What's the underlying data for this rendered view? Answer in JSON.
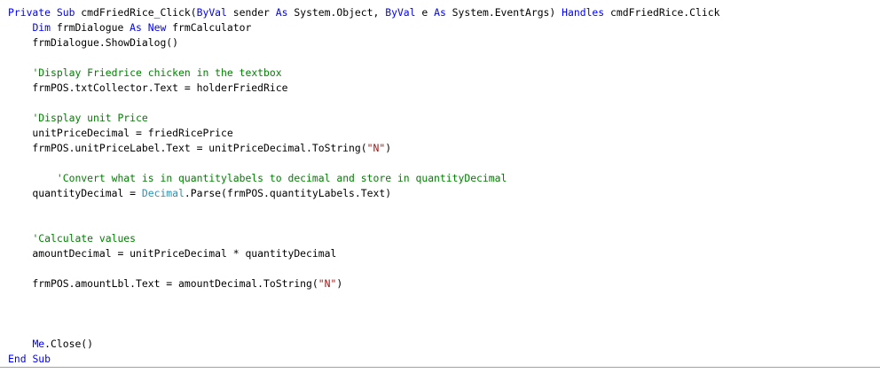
{
  "colors": {
    "keyword": "#0000ff",
    "comment": "#008000",
    "string": "#a31515",
    "type": "#2b91af",
    "text": "#000000",
    "background": "#ffffff",
    "separator": "#a0a0a0"
  },
  "code": {
    "lines": [
      [
        {
          "t": "Private",
          "c": "kw"
        },
        {
          "t": " "
        },
        {
          "t": "Sub",
          "c": "kw"
        },
        {
          "t": " cmdFriedRice_Click("
        },
        {
          "t": "ByVal",
          "c": "kw"
        },
        {
          "t": " sender "
        },
        {
          "t": "As",
          "c": "kw"
        },
        {
          "t": " System.Object, "
        },
        {
          "t": "ByVal",
          "c": "kw"
        },
        {
          "t": " e "
        },
        {
          "t": "As",
          "c": "kw"
        },
        {
          "t": " System.EventArgs) "
        },
        {
          "t": "Handles",
          "c": "kw"
        },
        {
          "t": " cmdFriedRice.Click"
        }
      ],
      [
        {
          "t": "    "
        },
        {
          "t": "Dim",
          "c": "kw"
        },
        {
          "t": " frmDialogue "
        },
        {
          "t": "As",
          "c": "kw"
        },
        {
          "t": " "
        },
        {
          "t": "New",
          "c": "kw"
        },
        {
          "t": " frmCalculator"
        }
      ],
      [
        {
          "t": "    frmDialogue.ShowDialog()"
        }
      ],
      [],
      [
        {
          "t": "    "
        },
        {
          "t": "'Display Friedrice chicken in the textbox",
          "c": "cm"
        }
      ],
      [
        {
          "t": "    frmPOS.txtCollector.Text = holderFriedRice"
        }
      ],
      [],
      [
        {
          "t": "    "
        },
        {
          "t": "'Display unit Price",
          "c": "cm"
        }
      ],
      [
        {
          "t": "    unitPriceDecimal = friedRicePrice"
        }
      ],
      [
        {
          "t": "    frmPOS.unitPriceLabel.Text = unitPriceDecimal.ToString("
        },
        {
          "t": "\"N\"",
          "c": "st"
        },
        {
          "t": ")"
        }
      ],
      [],
      [
        {
          "t": "        "
        },
        {
          "t": "'Convert what is in quantitylabels to decimal and store in quantityDecimal",
          "c": "cm"
        }
      ],
      [
        {
          "t": "    quantityDecimal = "
        },
        {
          "t": "Decimal",
          "c": "ty"
        },
        {
          "t": ".Parse(frmPOS.quantityLabels.Text)"
        }
      ],
      [],
      [],
      [
        {
          "t": "    "
        },
        {
          "t": "'Calculate values",
          "c": "cm"
        }
      ],
      [
        {
          "t": "    amountDecimal = unitPriceDecimal * quantityDecimal"
        }
      ],
      [],
      [
        {
          "t": "    frmPOS.amountLbl.Text = amountDecimal.ToString("
        },
        {
          "t": "\"N\"",
          "c": "st"
        },
        {
          "t": ")"
        }
      ],
      [],
      [],
      [],
      [
        {
          "t": "    "
        },
        {
          "t": "Me",
          "c": "kw"
        },
        {
          "t": ".Close()"
        }
      ],
      [
        {
          "t": "End",
          "c": "kw"
        },
        {
          "t": " "
        },
        {
          "t": "Sub",
          "c": "kw"
        }
      ]
    ]
  }
}
